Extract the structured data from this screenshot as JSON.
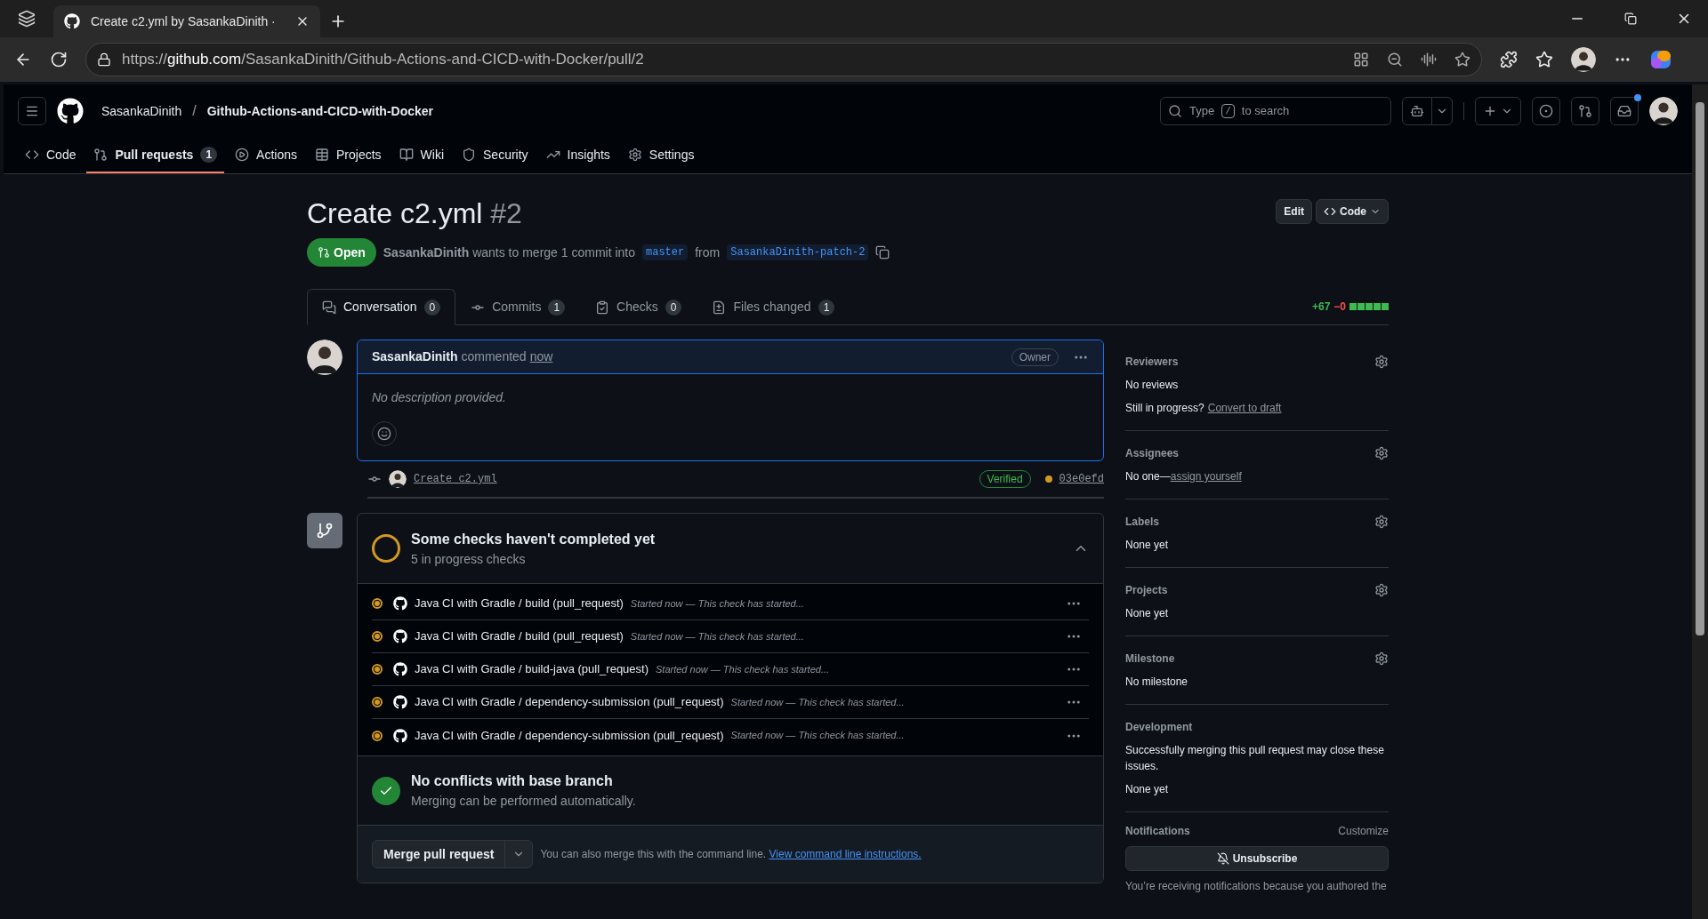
{
  "browser": {
    "tab_title": "Create c2.yml by SasankaDinith ·",
    "url_scheme": "https://",
    "url_host": "github.com",
    "url_path": "/SasankaDinith/Github-Actions-and-CICD-with-Docker/pull/2"
  },
  "repo": {
    "owner": "SasankaDinith",
    "separator": "/",
    "name": "Github-Actions-and-CICD-with-Docker"
  },
  "search": {
    "before": "Type",
    "key": "/",
    "after": "to search"
  },
  "notifications": {
    "unread": true
  },
  "nav": [
    {
      "label": "Code",
      "selected": false
    },
    {
      "label": "Pull requests",
      "count": "1",
      "selected": true
    },
    {
      "label": "Actions",
      "selected": false
    },
    {
      "label": "Projects",
      "selected": false
    },
    {
      "label": "Wiki",
      "selected": false
    },
    {
      "label": "Security",
      "selected": false
    },
    {
      "label": "Insights",
      "selected": false
    },
    {
      "label": "Settings",
      "selected": false
    }
  ],
  "pr": {
    "title": "Create c2.yml",
    "number": "#2",
    "state": "Open",
    "author": "SasankaDinith",
    "merge_text": "wants to merge 1 commit into",
    "base": "master",
    "from": "from",
    "head": "SasankaDinith-patch-2",
    "edit_button": "Edit",
    "code_button": "Code"
  },
  "tabs": [
    {
      "label": "Conversation",
      "count": "0",
      "selected": true
    },
    {
      "label": "Commits",
      "count": "1",
      "selected": false
    },
    {
      "label": "Checks",
      "count": "0",
      "selected": false
    },
    {
      "label": "Files changed",
      "count": "1",
      "selected": false
    }
  ],
  "diffstat": {
    "additions": "+67",
    "deletions": "−0"
  },
  "comment": {
    "author": "SasankaDinith",
    "verb": "commented",
    "time": "now",
    "role": "Owner",
    "body": "No description provided."
  },
  "commit": {
    "message": "Create c2.yml",
    "badge": "Verified",
    "sha": "03e0efd"
  },
  "checks": {
    "title": "Some checks haven't completed yet",
    "subtitle": "5 in progress checks",
    "expanded": true,
    "items": [
      {
        "name": "Java CI with Gradle / build (pull_request)",
        "detail": "Started now — This check has started...",
        "kind": "pending"
      },
      {
        "name": "Java CI with Gradle / build (pull_request)",
        "detail": "Started now — This check has started...",
        "kind": "pending"
      },
      {
        "name": "Java CI with Gradle / build-java (pull_request)",
        "detail": "Started now — This check has started...",
        "kind": "pending"
      },
      {
        "name": "Java CI with Gradle / dependency-submission (pull_request)",
        "detail": "Started now — This check has started...",
        "kind": "pending"
      },
      {
        "name": "Java CI with Gradle / dependency-submission (pull_request)",
        "detail": "Started now — This check has started...",
        "kind": "pending"
      }
    ]
  },
  "conflicts": {
    "title": "No conflicts with base branch",
    "subtitle": "Merging can be performed automatically.",
    "kind": "passed"
  },
  "merge": {
    "button": "Merge pull request",
    "note": "You can also merge this with the command line.",
    "link": "View command line instructions."
  },
  "sidebar": [
    {
      "heading": "Reviewers",
      "kind": "editable",
      "lines": [
        {
          "text": "No reviews"
        },
        {
          "text": "Still in progress?",
          "link": "Convert to draft"
        }
      ]
    },
    {
      "heading": "Assignees",
      "kind": "editable",
      "lines": [
        {
          "text": "No one—",
          "link": "assign yourself"
        }
      ]
    },
    {
      "heading": "Labels",
      "kind": "editable",
      "lines": [
        {
          "text": "None yet"
        }
      ]
    },
    {
      "heading": "Projects",
      "kind": "editable",
      "lines": [
        {
          "text": "None yet"
        }
      ]
    },
    {
      "heading": "Milestone",
      "kind": "editable",
      "lines": [
        {
          "text": "No milestone"
        }
      ]
    },
    {
      "heading": "Development",
      "kind": "info",
      "lines": [
        {
          "text": "Successfully merging this pull request may close these issues."
        },
        {
          "text": "None yet"
        }
      ]
    }
  ],
  "notifications_panel": {
    "heading": "Notifications",
    "customize": "Customize",
    "button": "Unsubscribe",
    "note": "You’re receiving notifications because you authored the"
  }
}
